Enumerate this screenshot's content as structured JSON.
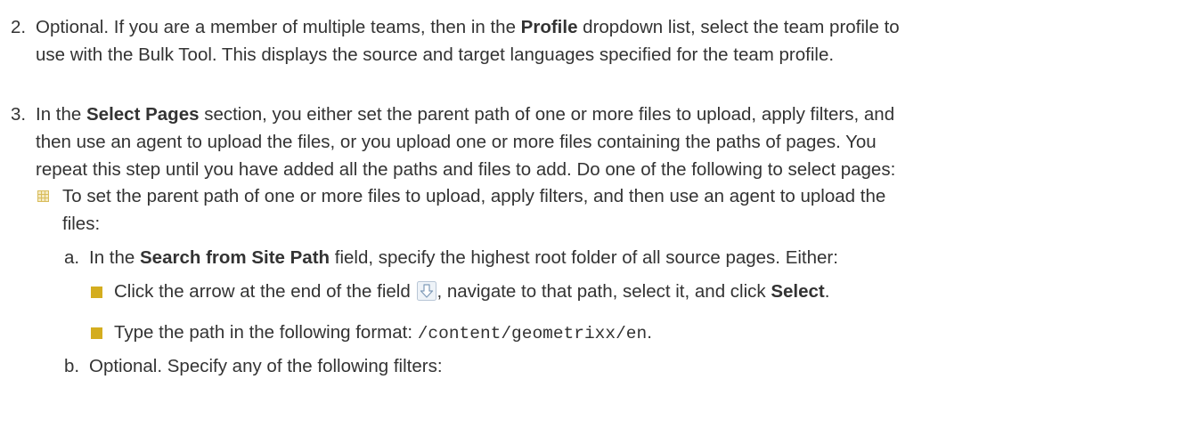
{
  "items": {
    "step2": {
      "num": "2.",
      "l1a": "Optional. If you are a member of multiple teams, then in the ",
      "l1b": "Profile",
      "l1c": " dropdown list, select the team profile to",
      "l2": "use with the Bulk Tool. This displays the source and target languages specified for the team profile."
    },
    "step3": {
      "num": "3.",
      "l1a": "In the ",
      "l1b": "Select Pages",
      "l1c": " section, you either set the parent path of one or more files to upload, apply filters, and",
      "l2": "then use an agent to upload the files, or you upload one or more files containing the paths of pages. You",
      "l3": "repeat this step until you have added all the paths and files to add. Do one of the following to select pages:"
    },
    "bullet": {
      "l1": "To set the parent path of one or more files to upload, apply filters, and then use an agent to upload the",
      "l2": "files:"
    },
    "sub_a": {
      "letter": "a.",
      "t1": "In the ",
      "t2": "Search from Site Path",
      "t3": " field, specify the highest root folder of all source pages. Either:"
    },
    "opt1": {
      "t1": "Click the arrow at the end of the field ",
      "t2": ", navigate to that path, select it, and click ",
      "t3": "Select",
      "t4": "."
    },
    "opt2": {
      "t1": "Type the path in the following format: ",
      "code": "/content/geometrixx/en",
      "t2": "."
    },
    "sub_b": {
      "letter": "b.",
      "text": "Optional. Specify any of the following filters:"
    }
  },
  "colors": {
    "text": "#333333",
    "bullet_square": "#d4ad1f",
    "grid_icon": "#e3cd7c"
  },
  "icons": {
    "list_bullet": "grid-icon",
    "level3_bullet": "square-icon",
    "field_arrow": "download-arrow-icon"
  }
}
